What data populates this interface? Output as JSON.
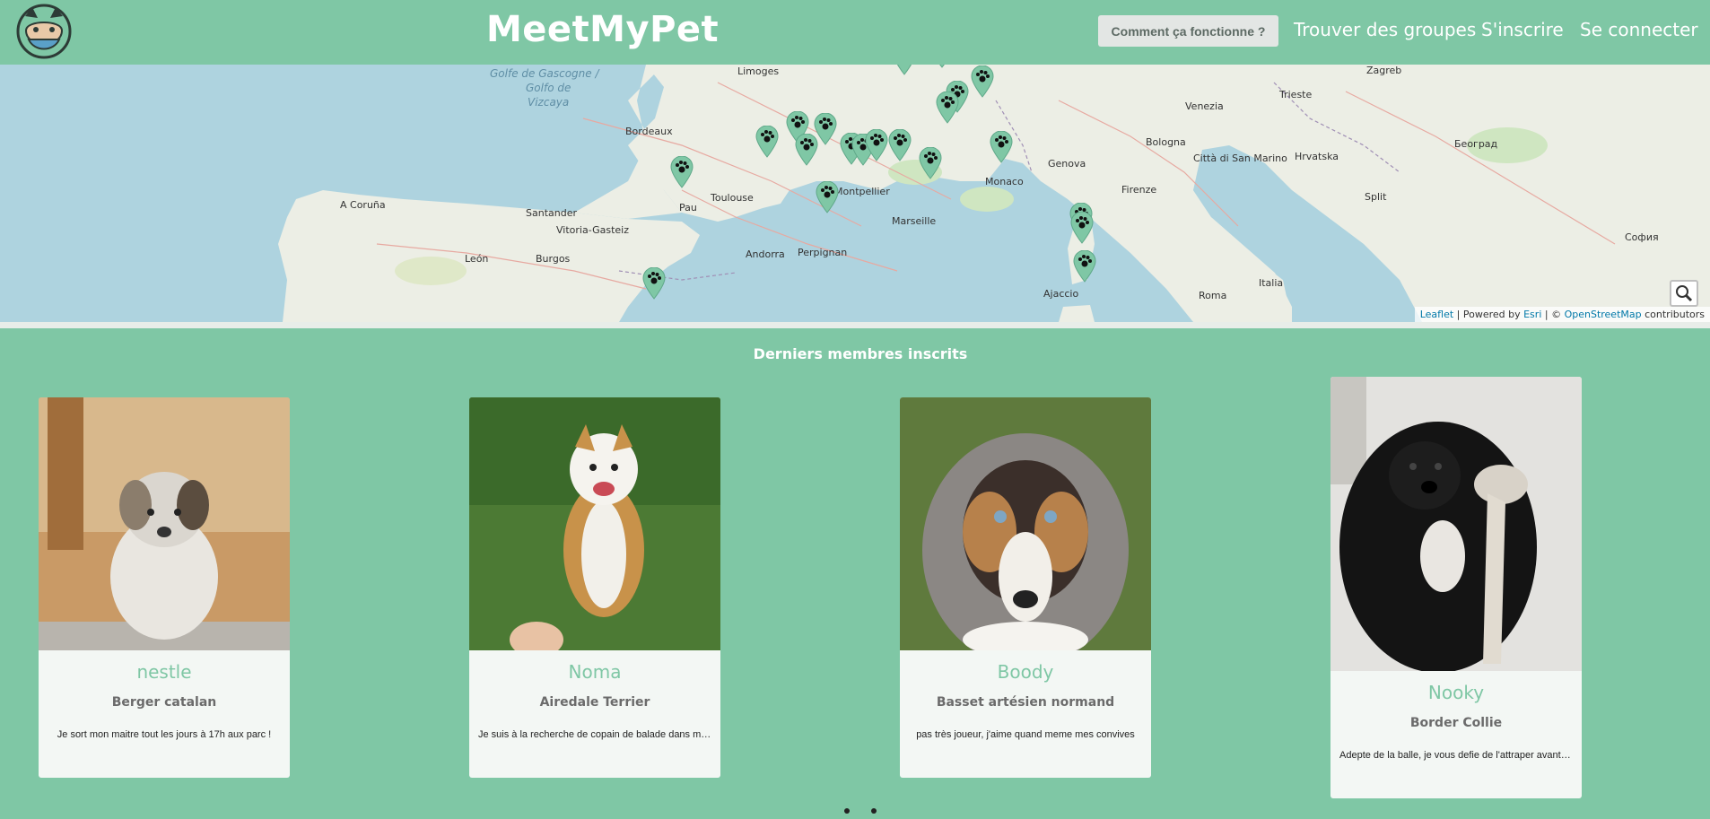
{
  "header": {
    "brand": "MeetMyPet",
    "nav": {
      "how_it_works": "Comment ça fonctionne ?",
      "find_groups": "Trouver des groupes",
      "signup": "S'inscrire",
      "login": "Se connecter"
    }
  },
  "map": {
    "labels": {
      "sea1": "Golfe de Gascogne /",
      "sea2": "Golfo de",
      "sea3": "Vizcaya",
      "bordeaux": "Bordeaux",
      "toulouse": "Toulouse",
      "montpellier": "Montpellier",
      "marseille": "Marseille",
      "monaco": "Monaco",
      "genova": "Genova",
      "bologna": "Bologna",
      "venezia": "Venezia",
      "firenze": "Firenze",
      "roma": "Roma",
      "zagreb": "Zagreb",
      "andorra": "Andorra",
      "perpignan": "Perpignan",
      "pau": "Pau",
      "limoges": "Limoges",
      "ajaccio": "Ajaccio",
      "vitoria": "Vitoria-Gasteiz",
      "leon": "León",
      "burgos": "Burgos",
      "trieste": "Trieste",
      "split": "Split",
      "italia": "Italia",
      "hrvatska": "Hrvatska",
      "beograd": "Београд",
      "sofia": "София",
      "acoruna": "A Coruña",
      "santander": "Santander",
      "sanmarino": "Città di San Marino"
    },
    "search_icon": "search-icon",
    "attribution": {
      "leaflet": "Leaflet",
      "powered": " | Powered by ",
      "esri": "Esri",
      "sep": " | © ",
      "osm": "OpenStreetMap",
      "contributors": " contributors"
    }
  },
  "section": {
    "title": "Derniers membres inscrits"
  },
  "cards": [
    {
      "name": "nestle",
      "breed": "Berger catalan",
      "desc": "Je sort mon maitre tout les jours à 17h aux parc !"
    },
    {
      "name": "Noma",
      "breed": "Airedale Terrier",
      "desc": "Je suis à la recherche de copain de balade dans mon …"
    },
    {
      "name": "Boody",
      "breed": "Basset artésien normand",
      "desc": "pas très joueur, j'aime quand meme mes convives"
    },
    {
      "name": "Nooky",
      "breed": "Border Collie",
      "desc": "Adepte de la balle, je vous defie de l'attraper avant moi"
    }
  ],
  "colors": {
    "accent": "#7fc7a5",
    "card_bg": "#f3f7f4",
    "sea": "#aed3df"
  }
}
